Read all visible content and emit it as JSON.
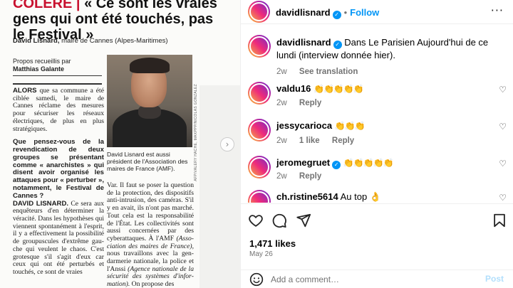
{
  "article": {
    "tag": "COLÈRE |",
    "headline": "« Ce sont les vraies gens qui ont été touchés, pas le Festival »",
    "byline_name": "David Lisnard,",
    "byline_role": "maire de Cannes (Alpes-Maritimes)",
    "propos_label": "Propos recueillis par",
    "propos_author": "Matthias Galante",
    "lead_bold": "ALORS",
    "lead_text": "que sa commune a été ciblée samedi, le maire de Cannes réclame des mesures pour sécuriser les réseaux électriques, de plus en plus stratégiques.",
    "question": "Que pensez-vous de la revendication de deux groupes se présentant comme « anarchistes » qui disent avoir organisé les attaques pour « perturber », notamment, le Festival de Cannes ?",
    "answer_bold": "DAVID LISNARD.",
    "answer_text": "Ce sera aux enquêteurs d'en détermi­ner la véracité. Dans les hypo­thèses qui viennent spontané­ment à l'esprit, il y a effectivement la possibilité de groupuscules d'extrême gau­che qui veulent le chaos. C'est grotesque s'il s'agit d'eux car ceux qui ont été perturbés et touchés, ce sont de vraies",
    "photo_credit": "AFP/VALERY HACHE, MAXPPP/NICOLAS GONZALEZ",
    "caption": "David Lisnard est aussi président de l'Association des maires de France (AMF).",
    "right_text_1": "Var. Il faut se poser la question de la protection, des dispositifs anti-intrusion, des caméras. S'il y en avait, ils n'ont pas marché. Tout cela est la responsabilité de l'État. Les collectivités sont aussi concernées par des cyberattaques. À l'AMF",
    "right_italic_1": "(Asso­ciation des maires de France),",
    "right_text_2": "nous travaillons avec la gen­darmerie nationale, la police et l'Anssi",
    "right_italic_2": "(Agence nationale de la sécurité des systèmes d'infor­mation).",
    "right_text_3": "On propose des"
  },
  "carousel": {
    "next_icon": "chevron-right-icon",
    "next_glyph": "›"
  },
  "header": {
    "username": "davidlisnard",
    "verified_glyph": "✓",
    "separator": "•",
    "follow_label": "Follow",
    "more_glyph": "···"
  },
  "caption_post": {
    "username": "davidlisnard",
    "text": "Dans Le Parisien Aujourd'hui de ce lundi (interview donnée hier).",
    "age": "2w",
    "see_translation": "See translation"
  },
  "comments": [
    {
      "username": "valdu16",
      "text": "👏👏👏👏👏",
      "age": "2w",
      "likes": "",
      "reply": "Reply"
    },
    {
      "username": "jessycarioca",
      "text": "👏👏👏",
      "age": "2w",
      "likes": "1 like",
      "reply": "Reply"
    },
    {
      "username": "jeromegruet",
      "text": "👏👏👏👏👏",
      "age": "2w",
      "likes": "",
      "reply": "Reply"
    },
    {
      "username": "ch.ristine5614",
      "text": "Au top 👌",
      "age": "",
      "likes": "",
      "reply": ""
    }
  ],
  "actions": {
    "likes_count": "1,471 likes",
    "date": "May 26",
    "add_comment_placeholder": "Add a comment…",
    "post_label": "Post"
  },
  "colors": {
    "accent": "#0095f6",
    "headline_tag": "#c8102e",
    "muted_text": "#737373",
    "post_disabled": "#b2dffc"
  }
}
